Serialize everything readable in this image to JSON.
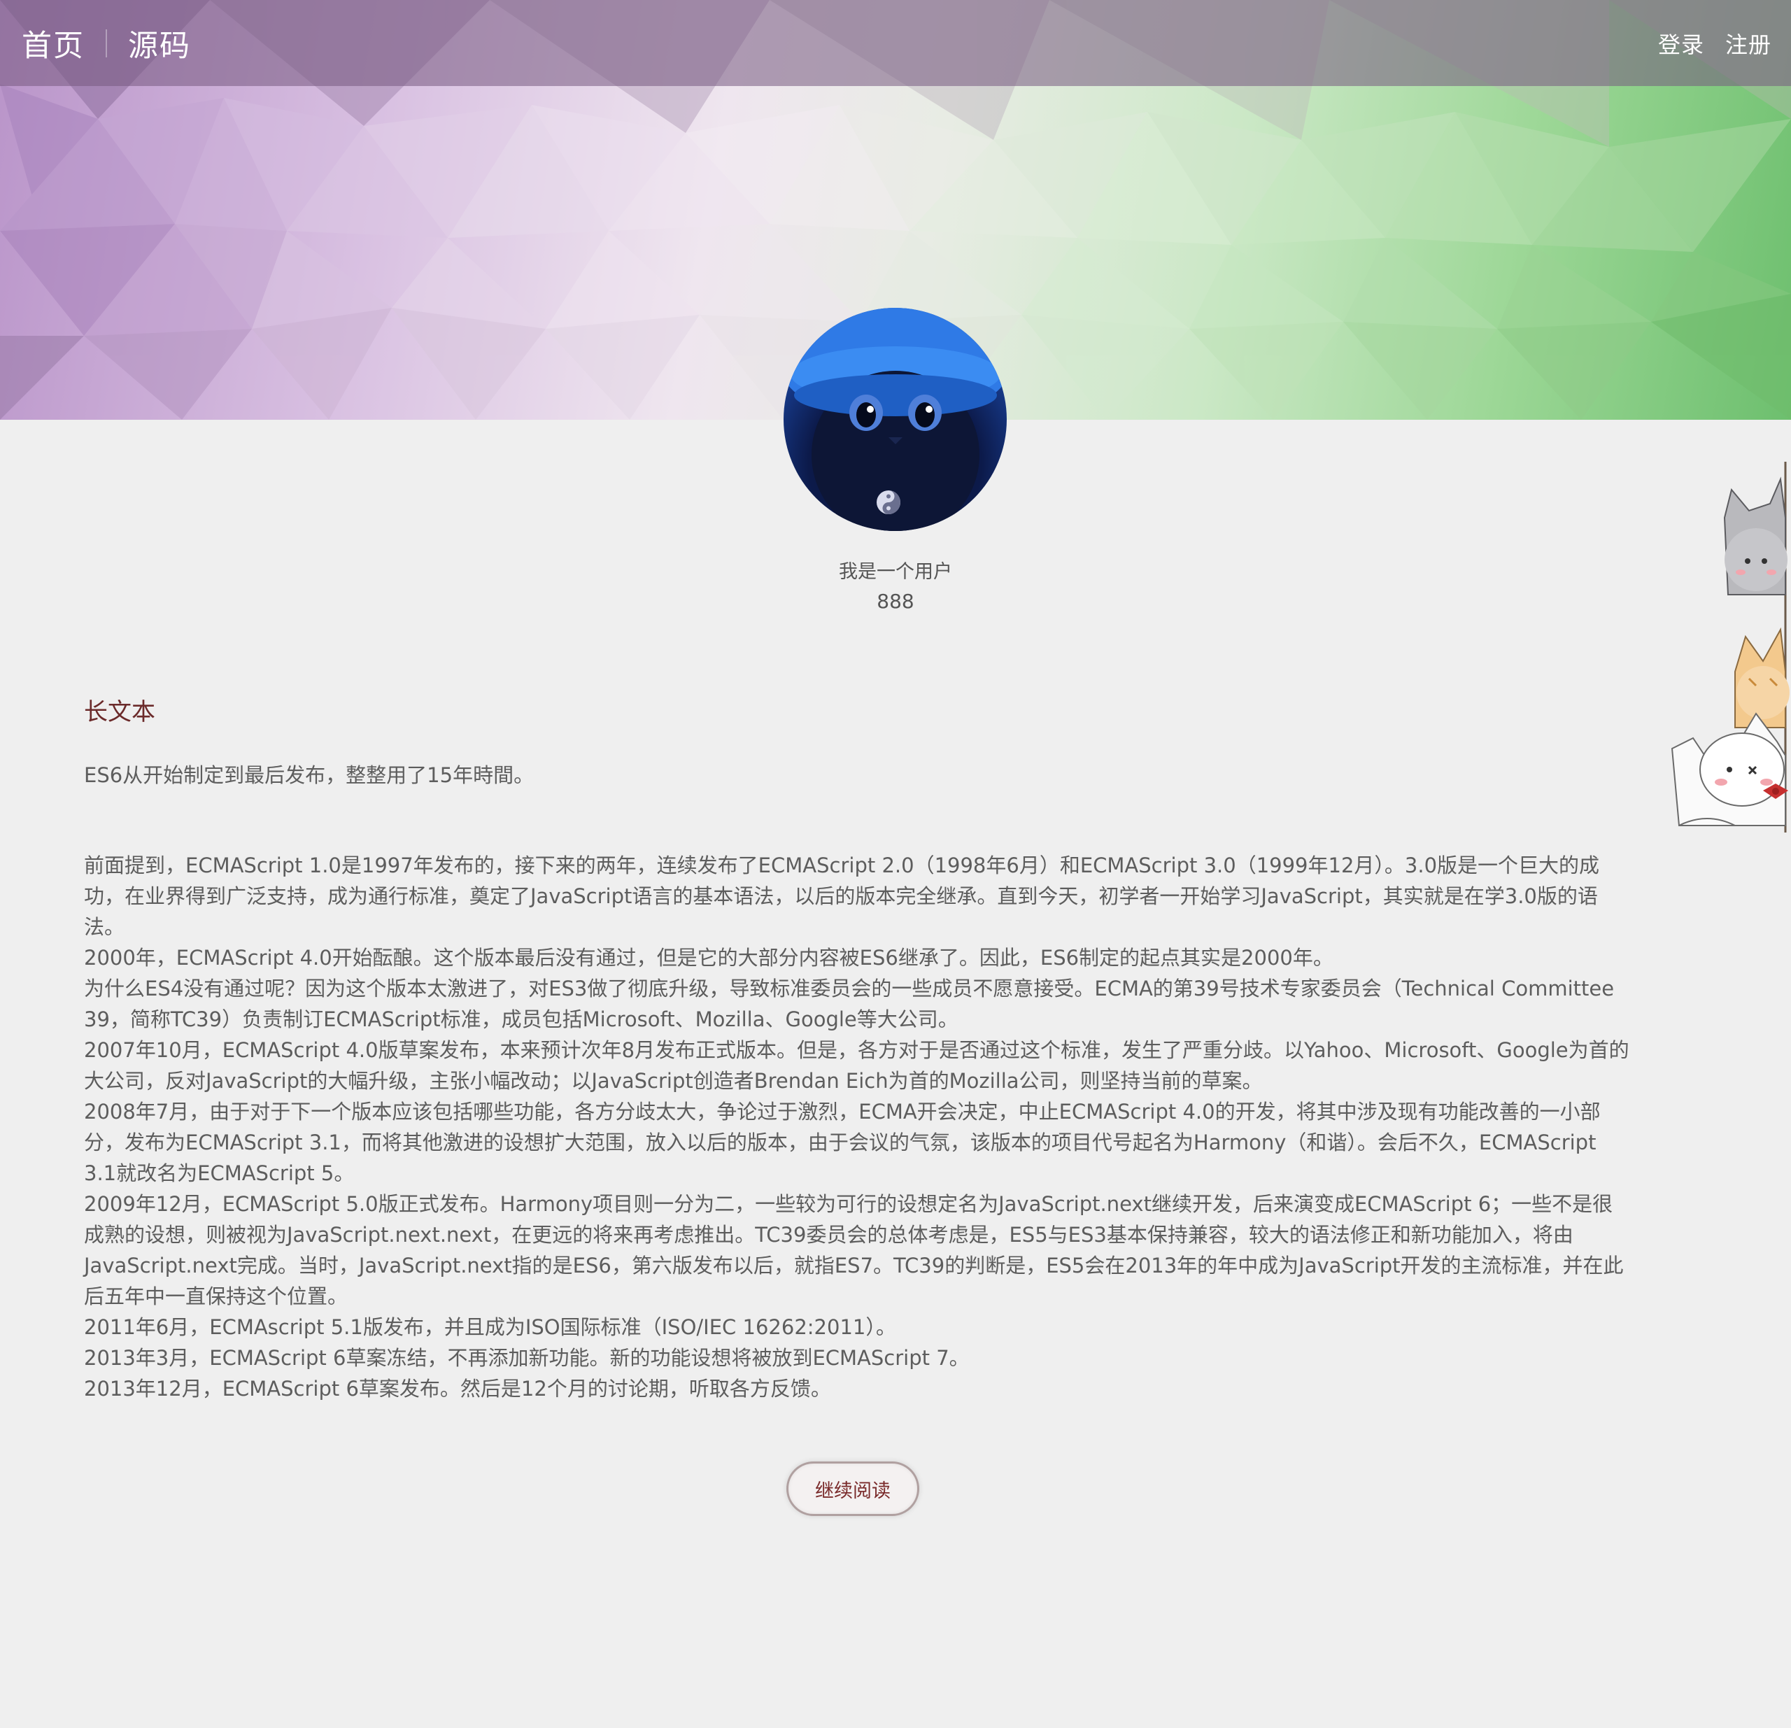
{
  "nav": {
    "home": "首页",
    "source": "源码",
    "login": "登录",
    "register": "注册"
  },
  "user": {
    "name": "我是一个用户",
    "count": "888"
  },
  "article": {
    "title": "长文本",
    "summary": "ES6从开始制定到最后发布，整整用了15年時間。",
    "paragraphs": [
      "前面提到，ECMAScript 1.0是1997年发布的，接下来的两年，连续发布了ECMAScript 2.0（1998年6月）和ECMAScript 3.0（1999年12月）。3.0版是一个巨大的成功，在业界得到广泛支持，成为通行标准，奠定了JavaScript语言的基本语法，以后的版本完全继承。直到今天，初学者一开始学习JavaScript，其实就是在学3.0版的语法。",
      "2000年，ECMAScript 4.0开始酝酿。这个版本最后没有通过，但是它的大部分内容被ES6继承了。因此，ES6制定的起点其实是2000年。",
      "为什么ES4没有通过呢？因为这个版本太激进了，对ES3做了彻底升级，导致标准委员会的一些成员不愿意接受。ECMA的第39号技术专家委员会（Technical Committee 39，简称TC39）负责制订ECMAScript标准，成员包括Microsoft、Mozilla、Google等大公司。",
      "2007年10月，ECMAScript 4.0版草案发布，本来预计次年8月发布正式版本。但是，各方对于是否通过这个标准，发生了严重分歧。以Yahoo、Microsoft、Google为首的大公司，反对JavaScript的大幅升级，主张小幅改动；以JavaScript创造者Brendan Eich为首的Mozilla公司，则坚持当前的草案。",
      "2008年7月，由于对于下一个版本应该包括哪些功能，各方分歧太大，争论过于激烈，ECMA开会决定，中止ECMAScript 4.0的开发，将其中涉及现有功能改善的一小部分，发布为ECMAScript 3.1，而将其他激进的设想扩大范围，放入以后的版本，由于会议的气氛，该版本的项目代号起名为Harmony（和谐）。会后不久，ECMAScript 3.1就改名为ECMAScript 5。",
      "2009年12月，ECMAScript 5.0版正式发布。Harmony项目则一分为二，一些较为可行的设想定名为JavaScript.next继续开发，后来演变成ECMAScript 6；一些不是很成熟的设想，则被视为JavaScript.next.next，在更远的将来再考虑推出。TC39委员会的总体考虑是，ES5与ES3基本保持兼容，较大的语法修正和新功能加入，将由JavaScript.next完成。当时，JavaScript.next指的是ES6，第六版发布以后，就指ES7。TC39的判断是，ES5会在2013年的年中成为JavaScript开发的主流标准，并在此后五年中一直保持这个位置。",
      "2011年6月，ECMAscript 5.1版发布，并且成为ISO国际标准（ISO/IEC 16262:2011）。",
      "2013年3月，ECMAScript 6草案冻结，不再添加新功能。新的功能设想将被放到ECMAScript 7。",
      "2013年12月，ECMAScript 6草案发布。然后是12个月的讨论期，听取各方反馈。"
    ],
    "read_more": "继续阅读"
  },
  "colors": {
    "title": "#6b2a2a",
    "body_text": "#5d5d5d",
    "page_background": "#efefef"
  },
  "icons": {
    "avatar": "cat-with-blue-hat-avatar",
    "decoration": "stacked-cats-decoration"
  }
}
